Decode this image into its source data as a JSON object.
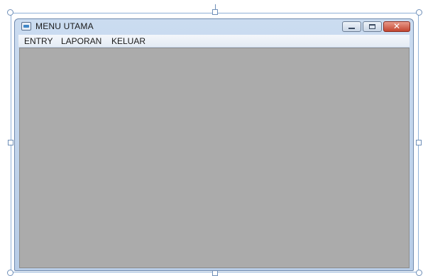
{
  "window": {
    "title": "MENU UTAMA",
    "icon": "app-window-icon",
    "controls": {
      "minimize": "minimize-icon",
      "maximize": "maximize-icon",
      "close": "close-icon",
      "close_glyph": "✕",
      "close_color": "#c3452f"
    }
  },
  "menu": {
    "items": [
      {
        "label": "ENTRY"
      },
      {
        "label": "LAPORAN"
      },
      {
        "label": "KELUAR"
      }
    ]
  },
  "client_area": {
    "background": "#ababab"
  }
}
